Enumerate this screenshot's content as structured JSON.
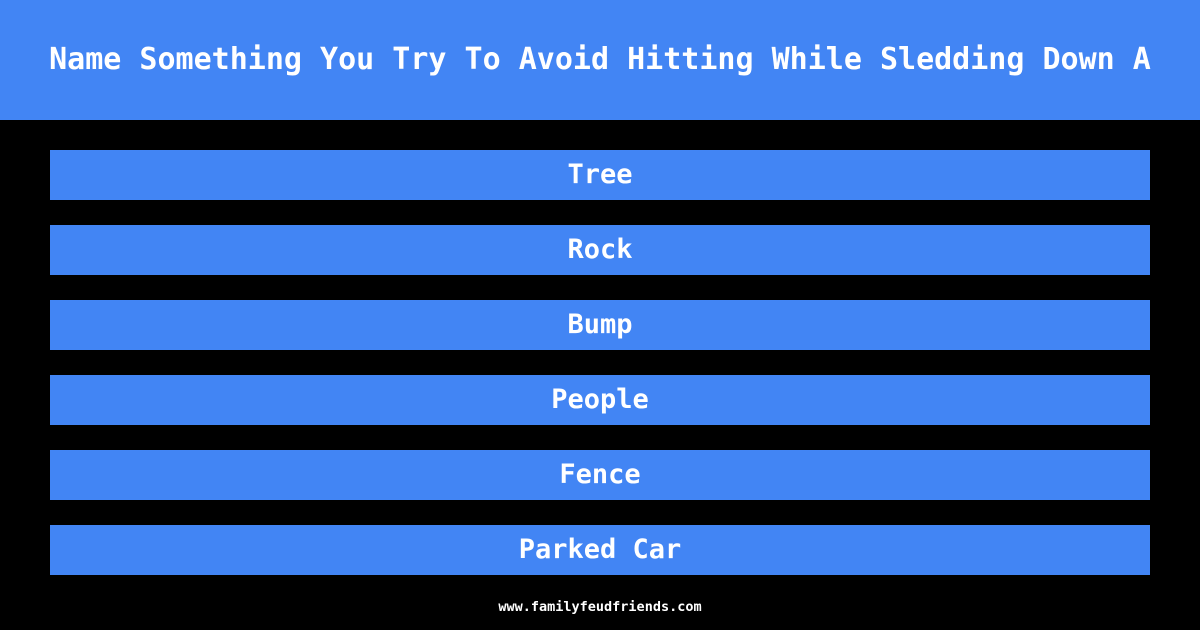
{
  "theme": {
    "background_color": "#000000",
    "accent_color": "#4285f4",
    "text_color": "#ffffff"
  },
  "header": {
    "title": "Name Something You Try To Avoid Hitting While Sledding Down A"
  },
  "answers": [
    {
      "label": "Tree"
    },
    {
      "label": "Rock"
    },
    {
      "label": "Bump"
    },
    {
      "label": "People"
    },
    {
      "label": "Fence"
    },
    {
      "label": "Parked Car"
    }
  ],
  "footer": {
    "site": "www.familyfeudfriends.com"
  }
}
